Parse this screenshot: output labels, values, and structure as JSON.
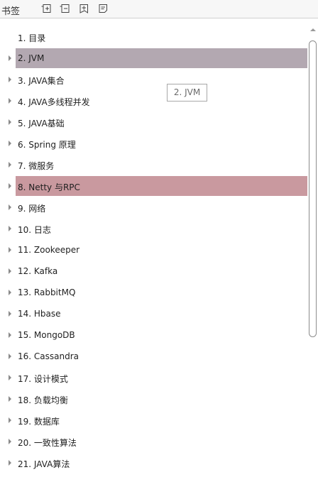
{
  "panel": {
    "title": "书签",
    "toolbar_icons": [
      "expand-all-icon",
      "collapse-all-icon",
      "add-bookmark-icon",
      "bookmark-options-icon"
    ]
  },
  "tooltip": "2. JVM",
  "bookmarks": [
    {
      "label": "1. 目录",
      "expandable": false
    },
    {
      "label": "2. JVM",
      "expandable": true,
      "state": "selected"
    },
    {
      "label": "3. JAVA集合",
      "expandable": true
    },
    {
      "label": "4. JAVA多线程并发",
      "expandable": true
    },
    {
      "label": "5. JAVA基础",
      "expandable": true
    },
    {
      "label": "6. Spring 原理",
      "expandable": true
    },
    {
      "label": "7.    微服务",
      "expandable": true
    },
    {
      "label": "8. Netty 与RPC",
      "expandable": true,
      "state": "hover"
    },
    {
      "label": "9. 网络",
      "expandable": true
    },
    {
      "label": "10. 日志",
      "expandable": true
    },
    {
      "label": "11. Zookeeper",
      "expandable": true
    },
    {
      "label": "12. Kafka",
      "expandable": true
    },
    {
      "label": "13. RabbitMQ",
      "expandable": true
    },
    {
      "label": "14. Hbase",
      "expandable": true
    },
    {
      "label": "15. MongoDB",
      "expandable": true
    },
    {
      "label": "16. Cassandra",
      "expandable": true
    },
    {
      "label": "17. 设计模式",
      "expandable": true
    },
    {
      "label": "18. 负载均衡",
      "expandable": true
    },
    {
      "label": "19. 数据库",
      "expandable": true
    },
    {
      "label": "20. 一致性算法",
      "expandable": true
    },
    {
      "label": "21. JAVA算法",
      "expandable": true
    }
  ],
  "colors": {
    "selected": "#b3a8b1",
    "hover": "#c9999f",
    "header_bg": "#f7f7f7"
  }
}
